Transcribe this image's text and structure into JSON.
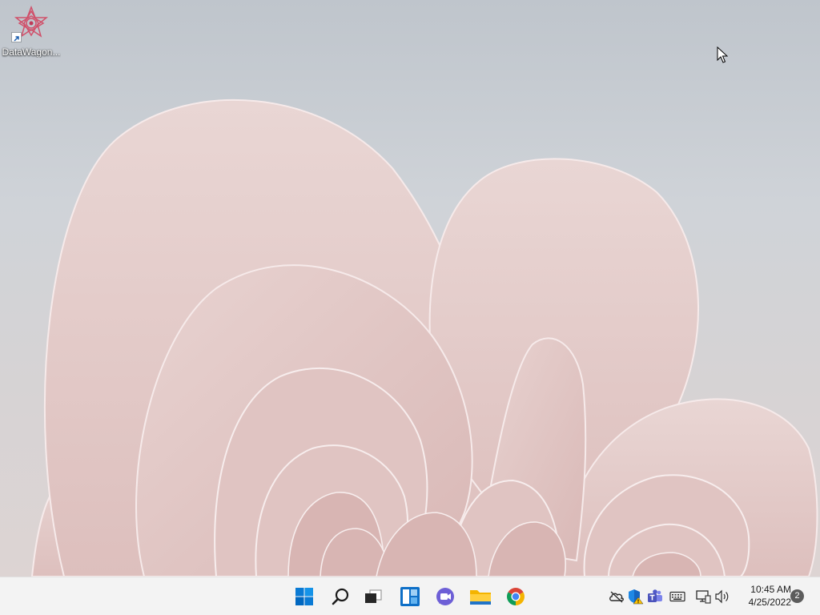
{
  "desktop": {
    "icons": [
      {
        "label": "DataWagon...",
        "icon": "datawagon-icon",
        "shortcut_overlay": "shortcut-arrow-icon"
      }
    ],
    "wallpaper": "pink-bloom-wallpaper",
    "colors": {
      "background": "#c8cdd3",
      "petal": "#e4c9c8"
    }
  },
  "taskbar": {
    "apps": [
      {
        "name": "Start",
        "icon": "windows-logo-icon"
      },
      {
        "name": "Search",
        "icon": "search-icon"
      },
      {
        "name": "Task View",
        "icon": "task-view-icon"
      },
      {
        "name": "Widgets",
        "icon": "widgets-icon"
      },
      {
        "name": "Chat",
        "icon": "chat-icon"
      },
      {
        "name": "File Explorer",
        "icon": "folder-icon"
      },
      {
        "name": "Google Chrome",
        "icon": "chrome-icon"
      }
    ],
    "tray": [
      {
        "name": "OneDrive",
        "icon": "onedrive-offline-icon"
      },
      {
        "name": "Windows Security",
        "icon": "security-warning-icon"
      },
      {
        "name": "Microsoft Teams",
        "icon": "teams-icon"
      },
      {
        "name": "Touch Keyboard",
        "icon": "keyboard-icon"
      },
      {
        "name": "Network",
        "icon": "network-icon"
      },
      {
        "name": "Volume",
        "icon": "volume-icon"
      }
    ],
    "clock": {
      "time": "10:45 AM",
      "date": "4/25/2022"
    },
    "notifications": {
      "count": "2"
    },
    "colors": {
      "background": "#f3f3f3",
      "start_blue": "#0078d4"
    }
  }
}
